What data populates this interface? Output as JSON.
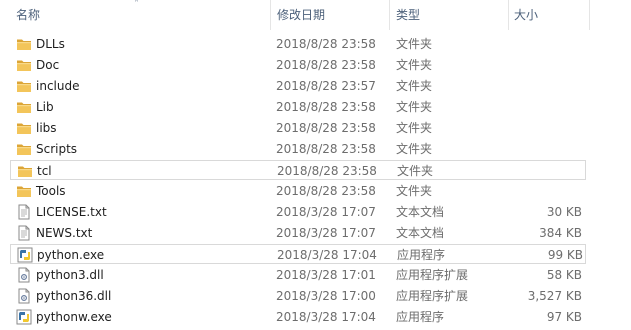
{
  "columns": {
    "name": "名称",
    "date": "修改日期",
    "type": "类型",
    "size": "大小"
  },
  "files": [
    {
      "name": "DLLs",
      "date": "2018/8/28 23:58",
      "type": "文件夹",
      "size": "",
      "icon": "folder-icon"
    },
    {
      "name": "Doc",
      "date": "2018/8/28 23:58",
      "type": "文件夹",
      "size": "",
      "icon": "folder-icon"
    },
    {
      "name": "include",
      "date": "2018/8/28 23:57",
      "type": "文件夹",
      "size": "",
      "icon": "folder-icon"
    },
    {
      "name": "Lib",
      "date": "2018/8/28 23:58",
      "type": "文件夹",
      "size": "",
      "icon": "folder-icon"
    },
    {
      "name": "libs",
      "date": "2018/8/28 23:58",
      "type": "文件夹",
      "size": "",
      "icon": "folder-icon"
    },
    {
      "name": "Scripts",
      "date": "2018/8/28 23:58",
      "type": "文件夹",
      "size": "",
      "icon": "folder-icon"
    },
    {
      "name": "tcl",
      "date": "2018/8/28 23:58",
      "type": "文件夹",
      "size": "",
      "icon": "folder-icon"
    },
    {
      "name": "Tools",
      "date": "2018/8/28 23:58",
      "type": "文件夹",
      "size": "",
      "icon": "folder-icon"
    },
    {
      "name": "LICENSE.txt",
      "date": "2018/3/28 17:07",
      "type": "文本文档",
      "size": "30 KB",
      "icon": "text-file-icon"
    },
    {
      "name": "NEWS.txt",
      "date": "2018/3/28 17:07",
      "type": "文本文档",
      "size": "384 KB",
      "icon": "text-file-icon"
    },
    {
      "name": "python.exe",
      "date": "2018/3/28 17:04",
      "type": "应用程序",
      "size": "99 KB",
      "icon": "python-exe-icon"
    },
    {
      "name": "python3.dll",
      "date": "2018/3/28 17:01",
      "type": "应用程序扩展",
      "size": "58 KB",
      "icon": "dll-file-icon"
    },
    {
      "name": "python36.dll",
      "date": "2018/3/28 17:00",
      "type": "应用程序扩展",
      "size": "3,527 KB",
      "icon": "dll-file-icon"
    },
    {
      "name": "pythonw.exe",
      "date": "2018/3/28 17:04",
      "type": "应用程序",
      "size": "97 KB",
      "icon": "python-exe-icon"
    }
  ],
  "hover_row": "tcl",
  "selected_row": "python.exe",
  "colors": {
    "folder": "#e8b64a",
    "header_text": "#4c607a",
    "secondary_text": "#6d6d6d"
  }
}
